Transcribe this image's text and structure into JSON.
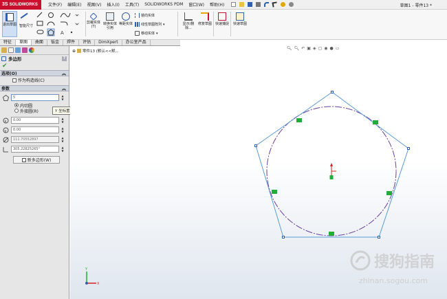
{
  "app": {
    "logo_text": "SOLIDWORKS",
    "document_title": "草图1 - 零件13 *"
  },
  "menu": [
    "文件(F)",
    "编辑(E)",
    "视图(V)",
    "插入(I)",
    "工具(T)",
    "SOLIDWORKS PDM",
    "窗口(W)",
    "帮助(H)"
  ],
  "ribbon": {
    "exit_sketch": "退出草图",
    "smart_dimension": "智能尺寸",
    "trim_entities": "剪裁实体(T)",
    "convert_entities": "转换实体引用",
    "offset_entities": "等距实体",
    "mirror_entities": "镜向实体",
    "linear_pattern": "线性草图阵列",
    "move_entities": "移动实体",
    "display_relations": "显示/删除...",
    "repair_sketch": "修复草图",
    "quick_snaps": "快速捕捉",
    "rapid_sketch": "快速草图"
  },
  "tabs": [
    "特征",
    "草图",
    "曲面",
    "钣金",
    "焊件",
    "评估",
    "DimXpert",
    "办公室产品"
  ],
  "active_tab": "草图",
  "property_manager": {
    "title": "多边形",
    "options_header": "选项(O)",
    "construction_label": "作为构造线(C)",
    "params_header": "参数",
    "sides_value": "5",
    "inscribed_label": "内切圆",
    "circumscribed_label": "外接圆(R)",
    "center_x": "0.00",
    "center_y": "0.00",
    "diameter": "111.70552897",
    "angle": "305.22825265°",
    "new_polygon_button": "新多边形(W)",
    "tooltip": "Y 坐标置中"
  },
  "graphics": {
    "feature_tree_item": "零件13 (默认<<默...",
    "watermark_text": "搜狗指南",
    "watermark_url": "zhinan.sogou.com"
  },
  "colors": {
    "polygon_line": "#5b9bd5",
    "circle_line": "#6a3fa0",
    "relation_badge": "#1fae3a",
    "origin_red": "#d32020",
    "brand_red": "#c8102e"
  }
}
